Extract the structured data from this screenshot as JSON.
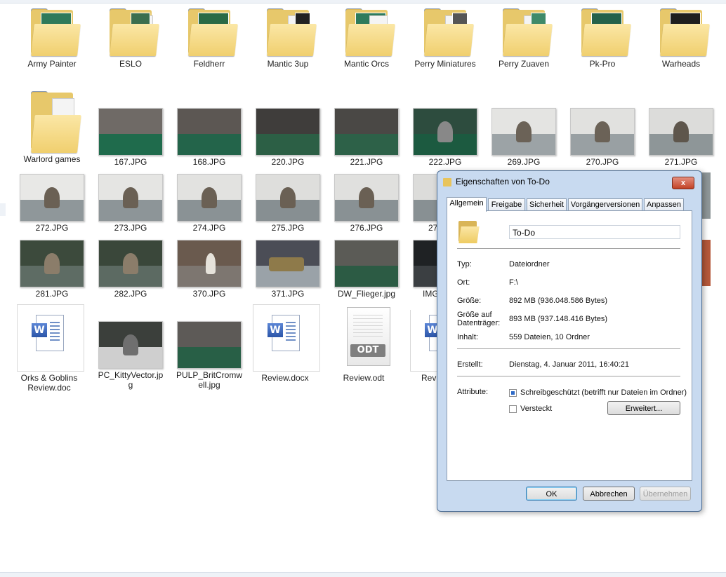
{
  "folders_row": [
    {
      "label": "Army Painter"
    },
    {
      "label": "ESLO"
    },
    {
      "label": "Feldherr"
    },
    {
      "label": "Mantic 3up"
    },
    {
      "label": "Mantic Orcs"
    },
    {
      "label": "Perry Miniatures"
    },
    {
      "label": "Perry Zuaven"
    },
    {
      "label": "Pk-Pro"
    },
    {
      "label": "Warheads"
    }
  ],
  "row2": [
    {
      "label": "Warlord games"
    },
    {
      "label": "167.JPG"
    },
    {
      "label": "168.JPG"
    },
    {
      "label": "220.JPG"
    },
    {
      "label": "221.JPG"
    },
    {
      "label": "222.JPG"
    },
    {
      "label": "269.JPG"
    },
    {
      "label": "270.JPG"
    },
    {
      "label": "271.JPG"
    }
  ],
  "row3": [
    {
      "label": "272.JPG"
    },
    {
      "label": "273.JPG"
    },
    {
      "label": "274.JPG"
    },
    {
      "label": "275.JPG"
    },
    {
      "label": "276.JPG"
    },
    {
      "label": "27"
    }
  ],
  "row4": [
    {
      "label": "281.JPG"
    },
    {
      "label": "282.JPG"
    },
    {
      "label": "370.JPG"
    },
    {
      "label": "371.JPG"
    },
    {
      "label": "DW_Flieger.jpg"
    },
    {
      "label": "IMG"
    }
  ],
  "row5": [
    {
      "label_line1": "Orks & Goblins",
      "label_line2": "Review.doc"
    },
    {
      "label_line1": "PC_KittyVector.jp",
      "label_line2": "g"
    },
    {
      "label_line1": "PULP_BritCromw",
      "label_line2": "ell.jpg"
    },
    {
      "label_line1": "Review.docx",
      "label_line2": ""
    },
    {
      "label_line1": "Review.odt",
      "label_line2": ""
    },
    {
      "label_line1": "Revi",
      "label_line2": ""
    }
  ],
  "icons": {
    "word_letter": "W",
    "odt_tag": "ODT"
  },
  "dialog": {
    "title": "Eigenschaften von To-Do",
    "close_symbol": "x",
    "tabs": [
      "Allgemein",
      "Freigabe",
      "Sicherheit",
      "Vorgängerversionen",
      "Anpassen"
    ],
    "name_value": "To-Do",
    "rows": {
      "typ_label": "Typ:",
      "typ_value": "Dateiordner",
      "ort_label": "Ort:",
      "ort_value": "F:\\",
      "groesse_label": "Größe:",
      "groesse_value": "892 MB (936.048.586 Bytes)",
      "groesse_auf_label_line1": "Größe auf",
      "groesse_auf_label_line2": "Datenträger:",
      "groesse_auf_value": "893 MB (937.148.416 Bytes)",
      "inhalt_label": "Inhalt:",
      "inhalt_value": "559 Dateien, 10 Ordner",
      "erstellt_label": "Erstellt:",
      "erstellt_value": "Dienstag, 4. Januar 2011, 16:40:21",
      "attribute_label": "Attribute:",
      "schreibgeschuetzt_label": "Schreibgeschützt (betrifft nur Dateien im Ordner)",
      "versteckt_label": "Versteckt",
      "erweitert_button": "Erweitert..."
    },
    "buttons": {
      "ok": "OK",
      "cancel": "Abbrechen",
      "apply": "Übernehmen"
    }
  },
  "colors": {
    "accent": "#3c7fb1",
    "folder": "#f0cf6e",
    "close": "#c24326"
  }
}
